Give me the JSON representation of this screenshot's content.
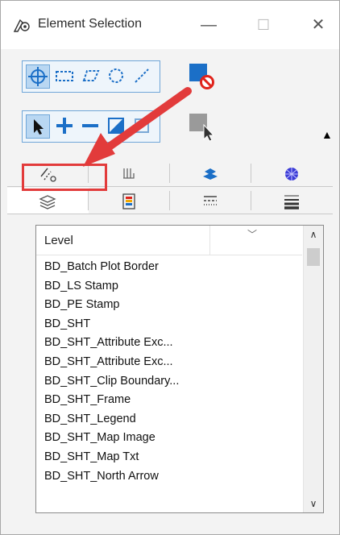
{
  "window": {
    "title": "Element Selection",
    "minimize": "—",
    "maximize": "☐",
    "close": "✕"
  },
  "toolbar1": {
    "icons": [
      "crosshair-icon",
      "rectangle-select-icon",
      "polygon-select-icon",
      "circle-select-icon",
      "line-select-icon"
    ],
    "extra": "no-selection-icon"
  },
  "toolbar2": {
    "icons": [
      "pointer-icon",
      "add-icon",
      "subtract-icon",
      "invert-icon",
      "toggle-icon"
    ],
    "extra": "select-pointer-icon",
    "expand": "▲"
  },
  "tabs_row1": [
    "line-style-icon",
    "weight-icon",
    "display-icon",
    "material-icon"
  ],
  "tabs_row2": [
    "levels-icon",
    "color-icon",
    "styles-icon",
    "weights-icon"
  ],
  "level_list": {
    "header": "Level",
    "items": [
      "BD_Batch Plot Border",
      "BD_LS Stamp",
      "BD_PE Stamp",
      "BD_SHT",
      "BD_SHT_Attribute Exc...",
      "BD_SHT_Attribute Exc...",
      "BD_SHT_Clip Boundary...",
      "BD_SHT_Frame",
      "BD_SHT_Legend",
      "BD_SHT_Map Image",
      "BD_SHT_Map Txt",
      "BD_SHT_North Arrow"
    ]
  },
  "annotation": {
    "color": "#e23b3b"
  }
}
